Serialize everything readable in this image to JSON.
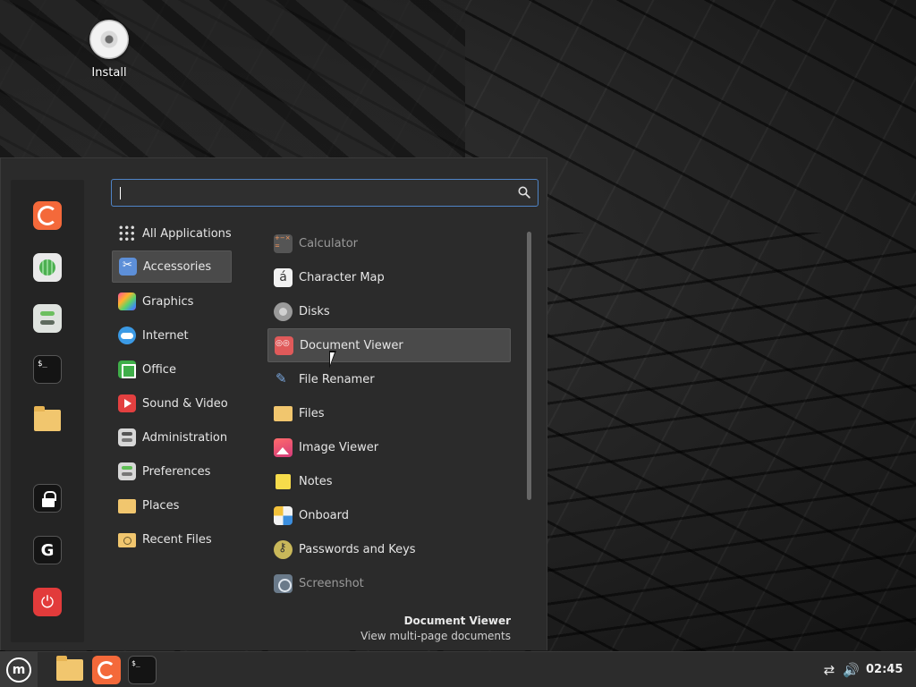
{
  "desktop": {
    "icons": [
      {
        "label": "Install",
        "icon": "disc-icon"
      }
    ]
  },
  "menu": {
    "search": {
      "value": "",
      "placeholder": ""
    },
    "favorites": [
      {
        "name": "firefox",
        "icon": "firefox-icon"
      },
      {
        "name": "software-manager",
        "icon": "software-manager-icon"
      },
      {
        "name": "system-settings",
        "icon": "settings-toggle-icon"
      },
      {
        "name": "terminal",
        "icon": "terminal-icon",
        "glyph": "$_"
      },
      {
        "name": "files",
        "icon": "folder-icon"
      },
      {
        "name": "lock-screen",
        "icon": "lock-icon"
      },
      {
        "name": "logout",
        "icon": "logout-icon",
        "glyph": "G"
      },
      {
        "name": "quit",
        "icon": "power-icon",
        "glyph": "⏻"
      }
    ],
    "categories": [
      {
        "label": "All Applications",
        "icon": "grid-icon"
      },
      {
        "label": "Accessories",
        "icon": "accessories-icon",
        "selected": true
      },
      {
        "label": "Graphics",
        "icon": "graphics-icon"
      },
      {
        "label": "Internet",
        "icon": "internet-icon"
      },
      {
        "label": "Office",
        "icon": "office-icon"
      },
      {
        "label": "Sound & Video",
        "icon": "sound-video-icon"
      },
      {
        "label": "Administration",
        "icon": "administration-icon"
      },
      {
        "label": "Preferences",
        "icon": "preferences-icon"
      },
      {
        "label": "Places",
        "icon": "folder-icon"
      },
      {
        "label": "Recent Files",
        "icon": "recent-files-icon"
      }
    ],
    "apps": [
      {
        "label": "Calculator",
        "icon": "calculator-icon",
        "dimmed": true
      },
      {
        "label": "Character Map",
        "icon": "character-map-icon",
        "glyph": "á"
      },
      {
        "label": "Disks",
        "icon": "disks-icon"
      },
      {
        "label": "Document Viewer",
        "icon": "document-viewer-icon",
        "hovered": true
      },
      {
        "label": "File Renamer",
        "icon": "file-renamer-icon"
      },
      {
        "label": "Files",
        "icon": "folder-icon"
      },
      {
        "label": "Image Viewer",
        "icon": "image-viewer-icon"
      },
      {
        "label": "Notes",
        "icon": "notes-icon"
      },
      {
        "label": "Onboard",
        "icon": "onboard-icon"
      },
      {
        "label": "Passwords and Keys",
        "icon": "passwords-keys-icon"
      },
      {
        "label": "Screenshot",
        "icon": "screenshot-icon",
        "dimmed": true
      }
    ],
    "description": {
      "title": "Document Viewer",
      "subtitle": "View multi-page documents"
    }
  },
  "panel": {
    "menu_button_glyph": "m",
    "launchers": [
      {
        "name": "files",
        "icon": "folder-icon"
      },
      {
        "name": "firefox",
        "icon": "firefox-icon"
      },
      {
        "name": "terminal",
        "icon": "terminal-icon",
        "glyph": "$_"
      }
    ],
    "tray": {
      "network_icon": "network-disconnected-icon",
      "network_glyph": "⇄",
      "volume_icon": "volume-icon",
      "volume_glyph": "🔊",
      "clock": "02:45"
    }
  },
  "colors": {
    "accent": "#4f84c7",
    "menu_bg": "#2b2b2b",
    "panel_bg": "#2c2c2c",
    "hover_bg": "#4a4a4a",
    "firefox": "#f4693a",
    "power": "#e23b3b"
  }
}
